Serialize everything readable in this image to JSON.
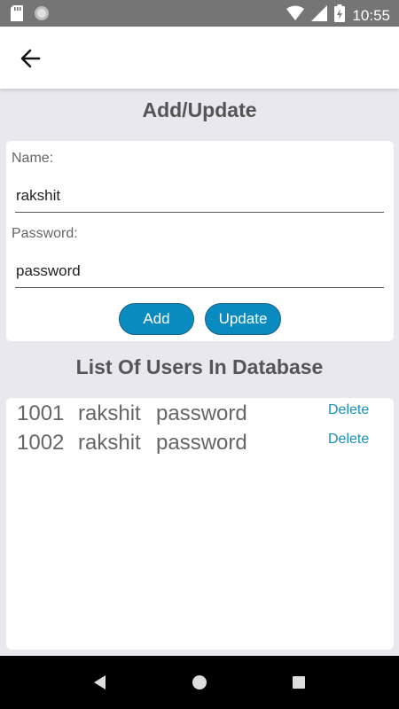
{
  "status_bar": {
    "time": "10:55",
    "icons": [
      "sd-card-icon",
      "circle-icon",
      "wifi-icon",
      "signal-icon",
      "battery-icon"
    ]
  },
  "app_bar": {
    "back_icon": "arrow-left-icon"
  },
  "form": {
    "title": "Add/Update",
    "name_label": "Name:",
    "name_value": "rakshit",
    "password_label": "Password:",
    "password_value": "password",
    "add_label": "Add",
    "update_label": "Update"
  },
  "list": {
    "title": "List Of Users In Database",
    "delete_label": "Delete",
    "rows": [
      {
        "id": "1001",
        "name": "rakshit",
        "password": "password",
        "action": "Delete"
      },
      {
        "id": "1002",
        "name": "rakshit",
        "password": "password",
        "action": "Delete"
      }
    ]
  },
  "nav_bar": {
    "icons": [
      "nav-back-icon",
      "nav-home-icon",
      "nav-recents-icon"
    ]
  },
  "colors": {
    "accent": "#0a8bc0",
    "delete_text": "#1a8fb8",
    "background": "#e8e8ee",
    "status_bar": "#757575"
  }
}
